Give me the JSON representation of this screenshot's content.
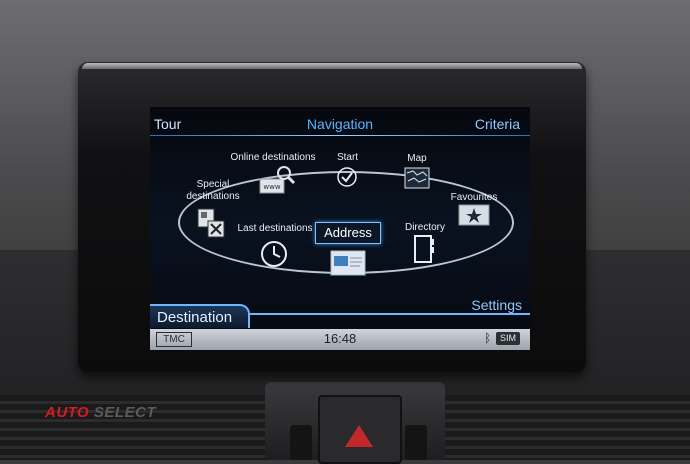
{
  "header": {
    "left_tab": "Tour",
    "title": "Navigation",
    "right_tab": "Criteria"
  },
  "menu": {
    "online_destinations": "Online destinations",
    "start": "Start",
    "map": "Map",
    "special_destinations": "Special destinations",
    "favourites": "Favourites",
    "last_destinations": "Last destinations",
    "address": "Address",
    "directory": "Directory",
    "www_label": "www"
  },
  "footer": {
    "destination_tab": "Destination",
    "settings_tab": "Settings",
    "tmc": "TMC",
    "time": "16:48",
    "bluetooth_symbol": "ᛒ",
    "sim": "SIM"
  },
  "branding": {
    "auto": "AUTO",
    "select": "SELECT"
  },
  "colors": {
    "accent": "#5cb4ff",
    "brand_red": "#d81b22"
  }
}
